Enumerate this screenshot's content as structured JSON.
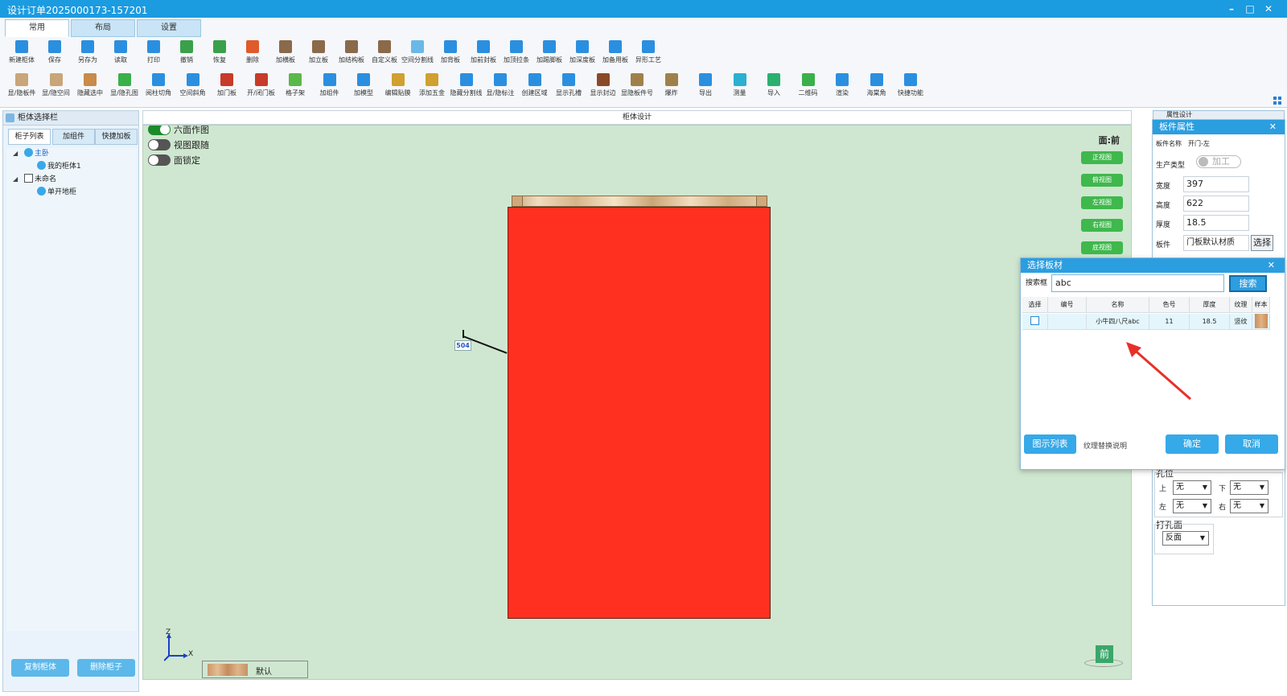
{
  "window": {
    "title": "设计订单2025000173-157201"
  },
  "ribbon": {
    "tabs": [
      {
        "label": "常用"
      },
      {
        "label": "布局"
      },
      {
        "label": "设置"
      }
    ],
    "row1": [
      {
        "label": "新建柜体",
        "icon": "new-cabinet-icon",
        "color": "#2b8fe0"
      },
      {
        "label": "保存",
        "icon": "save-icon",
        "color": "#2b8fe0"
      },
      {
        "label": "另存为",
        "icon": "save-as-icon",
        "color": "#2b8fe0"
      },
      {
        "label": "读取",
        "icon": "load-icon",
        "color": "#2b8fe0"
      },
      {
        "label": "打印",
        "icon": "print-icon",
        "color": "#2b8fe0"
      },
      {
        "label": "撤销",
        "icon": "undo-icon",
        "color": "#3aa04a"
      },
      {
        "label": "恢复",
        "icon": "redo-icon",
        "color": "#3aa04a"
      },
      {
        "label": "删除",
        "icon": "delete-icon",
        "color": "#e05a2b"
      },
      {
        "label": "加横板",
        "icon": "add-horizontal-board-icon",
        "color": "#8a6a4a"
      },
      {
        "label": "加立板",
        "icon": "add-vertical-board-icon",
        "color": "#8a6a4a"
      },
      {
        "label": "加结构板",
        "icon": "add-structure-board-icon",
        "color": "#8a6a4a"
      },
      {
        "label": "自定义板",
        "icon": "custom-board-icon",
        "color": "#8a6a4a"
      },
      {
        "label": "空间分割线",
        "icon": "space-split-icon",
        "color": "#6ab8e8"
      },
      {
        "label": "加背板",
        "icon": "add-back-board-icon",
        "color": "#2b8fe0"
      },
      {
        "label": "加前封板",
        "icon": "add-front-seal-icon",
        "color": "#2b8fe0"
      },
      {
        "label": "加顶拉条",
        "icon": "add-top-strip-icon",
        "color": "#2b8fe0"
      },
      {
        "label": "加踢脚板",
        "icon": "add-kickboard-icon",
        "color": "#2b8fe0"
      },
      {
        "label": "加深度板",
        "icon": "add-depth-board-icon",
        "color": "#2b8fe0"
      },
      {
        "label": "加备用板",
        "icon": "add-spare-board-icon",
        "color": "#2b8fe0"
      },
      {
        "label": "异形工艺",
        "icon": "special-process-icon",
        "color": "#2b8fe0"
      }
    ],
    "row2": [
      {
        "label": "显/隐板件",
        "icon": "toggle-board-icon",
        "color": "#c9a57a"
      },
      {
        "label": "显/隐空间",
        "icon": "toggle-space-icon",
        "color": "#c9a57a"
      },
      {
        "label": "隐藏选中",
        "icon": "hide-selected-icon",
        "color": "#c98a4a"
      },
      {
        "label": "显/隐孔图",
        "icon": "toggle-holes-icon",
        "color": "#3ab04a"
      },
      {
        "label": "阅柱切角",
        "icon": "column-cut-icon",
        "color": "#2b8fe0"
      },
      {
        "label": "空间斜角",
        "icon": "space-bevel-icon",
        "color": "#2b8fe0"
      },
      {
        "label": "加门板",
        "icon": "add-door-icon",
        "color": "#c83a2a"
      },
      {
        "label": "开/闭门板",
        "icon": "open-close-door-icon",
        "color": "#c83a2a"
      },
      {
        "label": "格子架",
        "icon": "grid-shelf-icon",
        "color": "#5ab84a"
      },
      {
        "label": "加组件",
        "icon": "add-component-icon",
        "color": "#2b8fe0"
      },
      {
        "label": "加模型",
        "icon": "add-model-icon",
        "color": "#2b8fe0"
      },
      {
        "label": "编辑贴膜",
        "icon": "edit-film-icon",
        "color": "#d0a030"
      },
      {
        "label": "添加五金",
        "icon": "add-hardware-icon",
        "color": "#d0a030"
      },
      {
        "label": "隐藏分割线",
        "icon": "hide-split-icon",
        "color": "#2b8fe0"
      },
      {
        "label": "显/隐标注",
        "icon": "toggle-annotation-icon",
        "color": "#2b8fe0"
      },
      {
        "label": "创建区域",
        "icon": "create-region-icon",
        "color": "#2b8fe0"
      },
      {
        "label": "显示孔槽",
        "icon": "show-holes-icon",
        "color": "#2b8fe0"
      },
      {
        "label": "显示封边",
        "icon": "show-edge-icon",
        "color": "#8a4a2a"
      },
      {
        "label": "显隐板件号",
        "icon": "toggle-board-number-icon",
        "color": "#a0804a"
      },
      {
        "label": "爆炸",
        "icon": "explode-icon",
        "color": "#a0804a"
      },
      {
        "label": "导出",
        "icon": "export-icon",
        "color": "#2b8fe0"
      },
      {
        "label": "测量",
        "icon": "measure-icon",
        "color": "#2bb0d0"
      },
      {
        "label": "导入",
        "icon": "import-icon",
        "color": "#2bb070"
      },
      {
        "label": "二维码",
        "icon": "qrcode-icon",
        "color": "#3ab04a"
      },
      {
        "label": "渲染",
        "icon": "render-icon",
        "color": "#2b8fe0"
      },
      {
        "label": "海棠角",
        "icon": "crabapple-corner-icon",
        "color": "#2b8fe0"
      },
      {
        "label": "快捷功能",
        "icon": "quick-function-icon",
        "color": "#2b8fe0"
      }
    ]
  },
  "left_panel": {
    "title": "柜体选择栏",
    "tabs": [
      "柜子列表",
      "加组件",
      "快捷加板"
    ],
    "tree": [
      {
        "label": "主卧",
        "level": 0
      },
      {
        "label": "我的柜体1",
        "level": 1
      },
      {
        "label": "未命名",
        "level": 0
      },
      {
        "label": "单开地柜",
        "level": 1
      }
    ],
    "copy_button": "复制柜体",
    "delete_button": "删除柜子"
  },
  "canvas": {
    "title": "柜体设计",
    "face_label": "面:前",
    "toggles": [
      {
        "label": "六面作图",
        "on": true
      },
      {
        "label": "视图跟随",
        "on": false
      },
      {
        "label": "面锁定",
        "on": false
      }
    ],
    "view_buttons": [
      "正视图",
      "俯视图",
      "左视图",
      "右视图",
      "底视图"
    ],
    "dimension": "504",
    "axis": {
      "z": "Z",
      "x": "X"
    },
    "material_name": "默认",
    "front_badge": "前",
    "door_color": "#ff3020"
  },
  "board_properties": {
    "title": "板件属性",
    "behind_title": "属性设计",
    "name_label": "板件名称",
    "name_value": "开门-左",
    "production_type_label": "生产类型",
    "production_type_value": "加工",
    "width_label": "宽度",
    "width_value": "397",
    "height_label": "高度",
    "height_value": "622",
    "thickness_label": "厚度",
    "thickness_value": "18.5",
    "material_label": "板件",
    "material_value": "门板默认材质",
    "select_button": "选择",
    "hole_position_title": "孔位",
    "hole_up_label": "上",
    "hole_up_value": "无",
    "hole_down_label": "下",
    "hole_down_value": "无",
    "hole_left_label": "左",
    "hole_left_value": "无",
    "hole_right_label": "右",
    "hole_right_value": "无",
    "drill_face_title": "打孔面",
    "drill_face_value": "反面"
  },
  "select_material_dialog": {
    "title": "选择板材",
    "search_label": "搜索框",
    "search_value": "abc",
    "search_button": "搜索",
    "columns": [
      "选择",
      "编号",
      "名称",
      "色号",
      "厚度",
      "纹理",
      "样本"
    ],
    "rows": [
      {
        "selected": false,
        "code": "",
        "name": "小牛四八尺abc",
        "color_no": "11",
        "thickness": "18.5",
        "texture": "竖纹"
      }
    ],
    "show_list_button": "图示列表",
    "texture_note": "纹理替换说明",
    "ok_button": "确定",
    "cancel_button": "取消"
  }
}
